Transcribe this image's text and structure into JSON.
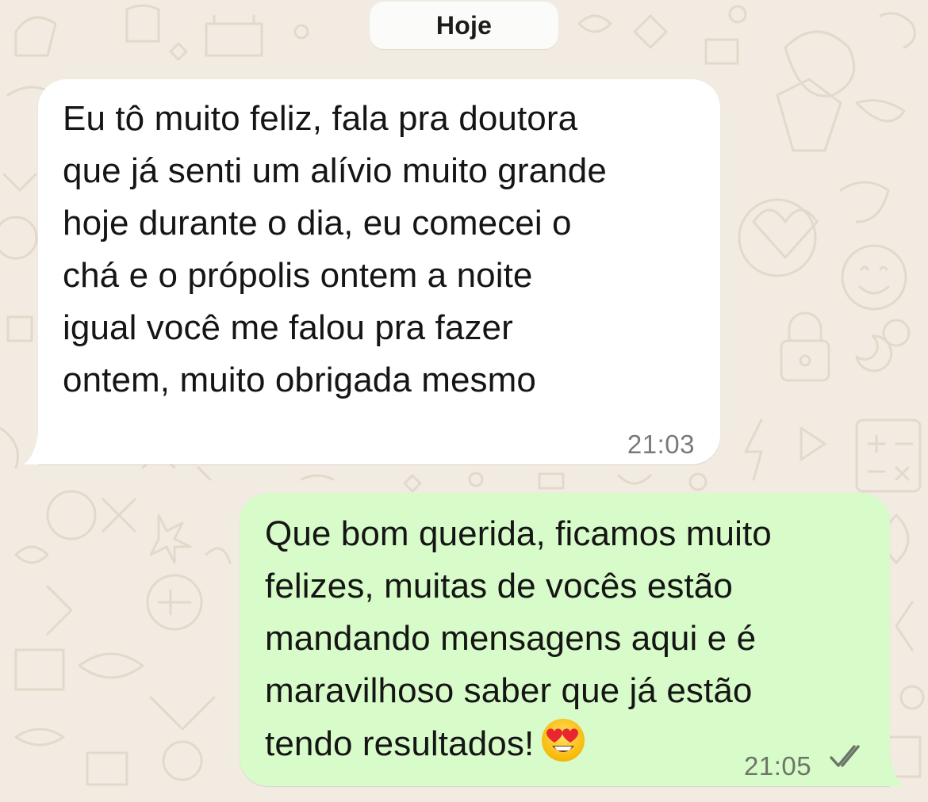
{
  "chat": {
    "date_label": "Hoje",
    "messages": [
      {
        "direction": "incoming",
        "text": "Eu tô muito feliz, fala pra doutora\nque já senti um alívio muito grande\nhoje durante o dia, eu comecei o\nchá e o própolis ontem a noite\nigual você me falou pra fazer\nontem, muito obrigada mesmo",
        "time": "21:03"
      },
      {
        "direction": "outgoing",
        "text": "Que bom querida, ficamos muito\nfelizes, muitas de vocês estão\nmandando mensagens aqui e é\nmaravilhoso saber que já estão\ntendo resultados!",
        "emoji": "heart-eyes-emoji",
        "time": "21:05",
        "status_icon": "double-check-icon"
      }
    ]
  },
  "colors": {
    "wallpaper": "#f1ebe2",
    "incoming_bubble": "#ffffff",
    "outgoing_bubble": "#d7fbc9",
    "timestamp": "#7a7a7a"
  }
}
